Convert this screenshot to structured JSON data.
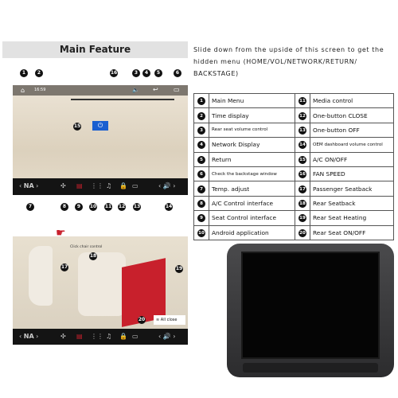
{
  "header": {
    "title": "Main Feature"
  },
  "intro": "Slide down from the upside of this screen to get the hidden menu (HOME/VOL/NETWORK/RETURN/ BACKSTAGE)",
  "screen1": {
    "time": "16:59",
    "temp": "NA"
  },
  "screen2": {
    "temp": "NA",
    "chair_hint": "Click chair control",
    "all_close": "All close"
  },
  "legend": [
    {
      "n": "1",
      "label": "Main Menu"
    },
    {
      "n": "2",
      "label": "Time display"
    },
    {
      "n": "3",
      "label": "Rear seat volume control"
    },
    {
      "n": "4",
      "label": "Network Display"
    },
    {
      "n": "5",
      "label": "Return"
    },
    {
      "n": "6",
      "label": "Check the backstage window"
    },
    {
      "n": "7",
      "label": "Temp. adjust"
    },
    {
      "n": "8",
      "label": "A/C Control interface"
    },
    {
      "n": "9",
      "label": "Seat Control interface"
    },
    {
      "n": "10",
      "label": "Android application"
    },
    {
      "n": "11",
      "label": "Media control"
    },
    {
      "n": "12",
      "label": "One-button CLOSE"
    },
    {
      "n": "13",
      "label": "One-button OFF"
    },
    {
      "n": "14",
      "label": "OEM dashboard volume control"
    },
    {
      "n": "15",
      "label": "A/C ON/OFF"
    },
    {
      "n": "16",
      "label": "FAN SPEED"
    },
    {
      "n": "17",
      "label": "Passenger Seatback"
    },
    {
      "n": "18",
      "label": "Rear Seatback"
    },
    {
      "n": "19",
      "label": "Rear Seat Heating"
    },
    {
      "n": "20",
      "label": "Rear Seat ON/OFF"
    }
  ],
  "colors": {
    "accent": "#1a5fd0",
    "heat": "#c8202c",
    "bar": "#141414"
  }
}
